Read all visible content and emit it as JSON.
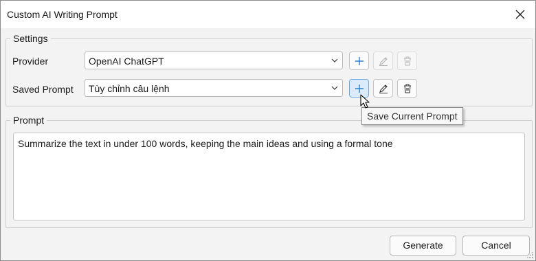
{
  "window": {
    "title": "Custom AI Writing Prompt",
    "close_icon": "close-icon"
  },
  "settings": {
    "legend": "Settings",
    "provider": {
      "label": "Provider",
      "value": "OpenAI ChatGPT",
      "add_icon": "plus-icon",
      "edit_icon": "pencil-icon",
      "delete_icon": "trash-icon",
      "edit_enabled": false,
      "delete_enabled": false
    },
    "saved_prompt": {
      "label": "Saved Prompt",
      "value": "Tùy chỉnh câu lệnh",
      "add_icon": "plus-icon",
      "edit_icon": "pencil-icon",
      "delete_icon": "trash-icon",
      "edit_enabled": true,
      "delete_enabled": true
    }
  },
  "tooltip": {
    "text": "Save Current Prompt"
  },
  "prompt": {
    "legend": "Prompt",
    "text": "Summarize the text in under 100 words, keeping the main ideas and using a formal tone"
  },
  "footer": {
    "generate_label": "Generate",
    "cancel_label": "Cancel"
  },
  "colors": {
    "accent": "#2a7fd4",
    "hover_bg": "#dcebfb",
    "disabled_icon": "#b3b3b3"
  }
}
